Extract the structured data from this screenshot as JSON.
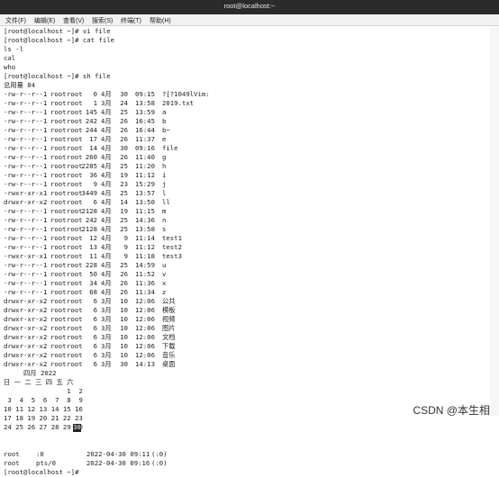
{
  "window": {
    "title": "root@localhost:~"
  },
  "menu": [
    "文件(F)",
    "编辑(E)",
    "查看(V)",
    "搜索(S)",
    "终端(T)",
    "帮助(H)"
  ],
  "terminal": {
    "pre_lines": [
      "[root@localhost ~]# vi file",
      "[root@localhost ~]# cat file",
      "ls -l",
      "cal",
      "who",
      "[root@localhost ~]# sh file",
      "总用量 84"
    ],
    "ls_rows": [
      [
        "-rw-r--r--.",
        "1",
        "root",
        "root",
        "0",
        "4月",
        "30",
        "09:15",
        "?[?1049lVim:"
      ],
      [
        "-rw-r--r--.",
        "1",
        "root",
        "root",
        "1",
        "3月",
        "24",
        "13:58",
        "2019.txt"
      ],
      [
        "-rw-r--r--.",
        "1",
        "root",
        "root",
        "145",
        "4月",
        "25",
        "13:59",
        "a"
      ],
      [
        "-rw-r--r--.",
        "1",
        "root",
        "root",
        "242",
        "4月",
        "26",
        "16:45",
        "b"
      ],
      [
        "-rw-r--r--.",
        "1",
        "root",
        "root",
        "244",
        "4月",
        "26",
        "16:44",
        "b~"
      ],
      [
        "-rw-r--r--.",
        "1",
        "root",
        "root",
        "17",
        "4月",
        "26",
        "11:37",
        "e"
      ],
      [
        "-rw-r--r--.",
        "1",
        "root",
        "root",
        "14",
        "4月",
        "30",
        "09:16",
        "file"
      ],
      [
        "-rw-r--r--.",
        "1",
        "root",
        "root",
        "260",
        "4月",
        "26",
        "11:40",
        "g"
      ],
      [
        "-rw-r--r--.",
        "1",
        "root",
        "root",
        "2285",
        "4月",
        "25",
        "11:20",
        "h"
      ],
      [
        "-rw-r--r--.",
        "1",
        "root",
        "root",
        "36",
        "4月",
        "19",
        "11:12",
        "i"
      ],
      [
        "-rw-r--r--.",
        "1",
        "root",
        "root",
        "9",
        "4月",
        "23",
        "15:29",
        "j"
      ],
      [
        "-rwxr-xr-x.",
        "1",
        "root",
        "root",
        "3449",
        "4月",
        "25",
        "13:57",
        "l"
      ],
      [
        "drwxr-xr-x.",
        "2",
        "root",
        "root",
        "6",
        "4月",
        "14",
        "13:50",
        "ll"
      ],
      [
        "-rw-r--r--.",
        "1",
        "root",
        "root",
        "2128",
        "4月",
        "19",
        "11:15",
        "m"
      ],
      [
        "-rw-r--r--.",
        "1",
        "root",
        "root",
        "242",
        "4月",
        "25",
        "14:36",
        "n"
      ],
      [
        "-rw-r--r--.",
        "1",
        "root",
        "root",
        "2128",
        "4月",
        "25",
        "13:58",
        "s"
      ],
      [
        "-rw-r--r--.",
        "1",
        "root",
        "root",
        "12",
        "4月",
        "9",
        "11:14",
        "test1"
      ],
      [
        "-rw-r--r--.",
        "1",
        "root",
        "root",
        "13",
        "4月",
        "9",
        "11:12",
        "test2"
      ],
      [
        "-rwxr-xr-x.",
        "1",
        "root",
        "root",
        "11",
        "4月",
        "9",
        "11:18",
        "test3"
      ],
      [
        "-rw-r--r--.",
        "1",
        "root",
        "root",
        "228",
        "4月",
        "25",
        "14:59",
        "u"
      ],
      [
        "-rw-r--r--.",
        "1",
        "root",
        "root",
        "50",
        "4月",
        "26",
        "11:52",
        "v"
      ],
      [
        "-rw-r--r--.",
        "1",
        "root",
        "root",
        "34",
        "4月",
        "26",
        "11:36",
        "x"
      ],
      [
        "-rw-r--r--.",
        "1",
        "root",
        "root",
        "68",
        "4月",
        "26",
        "11:34",
        "z"
      ],
      [
        "drwxr-xr-x.",
        "2",
        "root",
        "root",
        "6",
        "3月",
        "10",
        "12:06",
        "公共"
      ],
      [
        "drwxr-xr-x.",
        "2",
        "root",
        "root",
        "6",
        "3月",
        "10",
        "12:06",
        "模板"
      ],
      [
        "drwxr-xr-x.",
        "2",
        "root",
        "root",
        "6",
        "3月",
        "10",
        "12:06",
        "视频"
      ],
      [
        "drwxr-xr-x.",
        "2",
        "root",
        "root",
        "6",
        "3月",
        "10",
        "12:06",
        "图片"
      ],
      [
        "drwxr-xr-x.",
        "2",
        "root",
        "root",
        "6",
        "3月",
        "10",
        "12:06",
        "文档"
      ],
      [
        "drwxr-xr-x.",
        "2",
        "root",
        "root",
        "6",
        "3月",
        "10",
        "12:06",
        "下载"
      ],
      [
        "drwxr-xr-x.",
        "2",
        "root",
        "root",
        "6",
        "3月",
        "10",
        "12:06",
        "音乐"
      ],
      [
        "drwxr-xr-x.",
        "2",
        "root",
        "root",
        "6",
        "3月",
        "30",
        "14:13",
        "桌面"
      ]
    ],
    "calendar": {
      "header": "四月 2022",
      "weekdays": "日 一 二 三 四 五 六",
      "weeks": [
        "                1  2",
        " 3  4  5  6  7  8  9",
        "10 11 12 13 14 15 16",
        "17 18 19 20 21 22 23",
        "24 25 26 27 28 29 30"
      ],
      "today": "30"
    },
    "who": [
      {
        "user": "root",
        "tty": ":0",
        "time": "2022-04-30 09:11",
        "from": "(:0)"
      },
      {
        "user": "root",
        "tty": "pts/0",
        "time": "2022-04-30 09:16",
        "from": "(:0)"
      }
    ],
    "prompt": "[root@localhost ~]#"
  },
  "watermark": "CSDN @本生相"
}
